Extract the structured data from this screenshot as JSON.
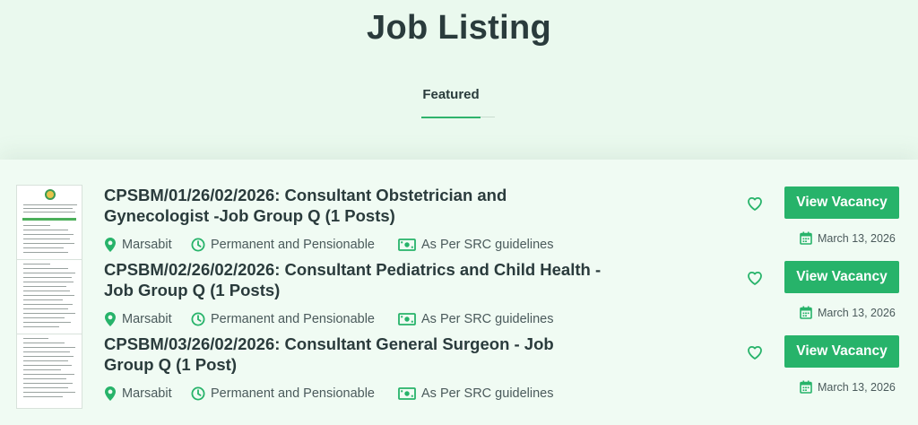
{
  "page": {
    "title": "Job Listing"
  },
  "tabs": [
    {
      "label": "Featured"
    }
  ],
  "colors": {
    "accent": "#27b36a",
    "background": "#eaf9ee",
    "text": "#2a3b3c"
  },
  "jobs": [
    {
      "title": "CPSBM/01/26/02/2026: Consultant Obstetrician and Gynecologist -Job Group Q (1 Posts)",
      "location": "Marsabit",
      "terms": "Permanent and Pensionable",
      "salary": "As Per SRC guidelines",
      "date": "March 13, 2026",
      "button_label": "View Vacancy"
    },
    {
      "title": "CPSBM/02/26/02/2026: Consultant Pediatrics and Child Health -Job Group Q (1 Posts)",
      "location": "Marsabit",
      "terms": "Permanent and Pensionable",
      "salary": "As Per SRC guidelines",
      "date": "March 13, 2026",
      "button_label": "View Vacancy"
    },
    {
      "title": "CPSBM/03/26/02/2026: Consultant General Surgeon - Job Group Q (1 Post)",
      "location": "Marsabit",
      "terms": "Permanent and Pensionable",
      "salary": "As Per SRC guidelines",
      "date": "March 13, 2026",
      "button_label": "View Vacancy"
    }
  ],
  "icons": {
    "location": "map-pin-icon",
    "terms": "clock-icon",
    "salary": "money-icon",
    "favorite": "heart-icon",
    "date": "calendar-icon"
  }
}
